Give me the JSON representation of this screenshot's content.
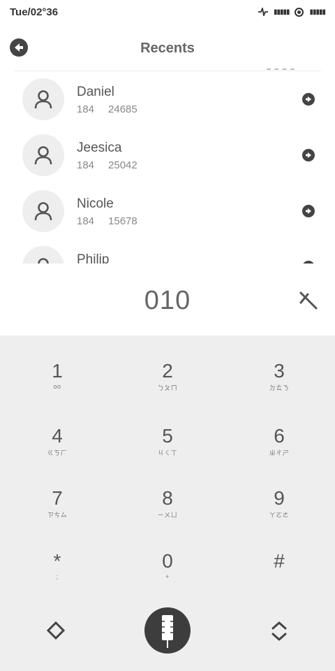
{
  "status": {
    "time": "Tue/02°36",
    "signal_1": "▮▮▮▮▮",
    "signal_2": "▮▮▮▮▮"
  },
  "header": {
    "title": "Recents"
  },
  "recents": [
    {
      "name": "Daniel",
      "area": "184",
      "number": "24685"
    },
    {
      "name": "Jeesica",
      "area": "184",
      "number": "25042"
    },
    {
      "name": "Nicole",
      "area": "184",
      "number": "15678"
    },
    {
      "name": "Philip",
      "area": "",
      "number": ""
    }
  ],
  "dialer": {
    "number": "010"
  },
  "keypad": [
    {
      "digit": "1",
      "sub": "oo"
    },
    {
      "digit": "2",
      "sub": "ㄅㄆㄇ"
    },
    {
      "digit": "3",
      "sub": "ㄉㄊㄋ"
    },
    {
      "digit": "4",
      "sub": "ㄍㄎㄏ"
    },
    {
      "digit": "5",
      "sub": "ㄐㄑㄒ"
    },
    {
      "digit": "6",
      "sub": "ㄓㄔㄕ"
    },
    {
      "digit": "7",
      "sub": "ㄗㄘㄙ"
    },
    {
      "digit": "8",
      "sub": "ㄧㄨㄩ"
    },
    {
      "digit": "9",
      "sub": "ㄚㄛㄜ"
    },
    {
      "digit": "*",
      "sub": ";"
    },
    {
      "digit": "0",
      "sub": "+"
    },
    {
      "digit": "#",
      "sub": ""
    }
  ],
  "icons": {
    "back": "back-arrow-icon",
    "clear": "backspace-icon",
    "call": "call-icon",
    "left": "diamond-icon",
    "right": "swap-icon"
  },
  "colors": {
    "accent": "#3d3d3d",
    "keypad_bg": "#eeeeee"
  }
}
